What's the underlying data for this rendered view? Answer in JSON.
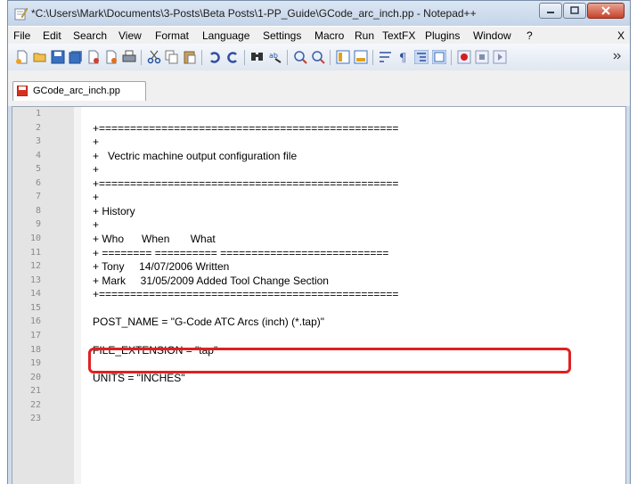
{
  "window": {
    "title": "*C:\\Users\\Mark\\Documents\\3-Posts\\Beta Posts\\1-PP_Guide\\GCode_arc_inch.pp - Notepad++"
  },
  "menu": {
    "items": [
      "File",
      "Edit",
      "Search",
      "View",
      "Format",
      "Language",
      "Settings",
      "Macro",
      "Run",
      "TextFX",
      "Plugins",
      "Window",
      "?"
    ],
    "close_label": "X"
  },
  "tab": {
    "label": "GCode_arc_inch.pp"
  },
  "editor": {
    "lines": [
      {
        "num": "1",
        "text": ""
      },
      {
        "num": "2",
        "text": "+================================================"
      },
      {
        "num": "3",
        "text": "+"
      },
      {
        "num": "4",
        "text": "+   Vectric machine output configuration file"
      },
      {
        "num": "5",
        "text": "+"
      },
      {
        "num": "6",
        "text": "+================================================"
      },
      {
        "num": "7",
        "text": "+"
      },
      {
        "num": "8",
        "text": "+ History"
      },
      {
        "num": "9",
        "text": "+"
      },
      {
        "num": "10",
        "text": "+ Who      When       What"
      },
      {
        "num": "11",
        "text": "+ ======== ========== ==========================="
      },
      {
        "num": "12",
        "text": "+ Tony     14/07/2006 Written"
      },
      {
        "num": "13",
        "text": "+ Mark     31/05/2009 Added Tool Change Section"
      },
      {
        "num": "14",
        "text": "+================================================"
      },
      {
        "num": "15",
        "text": ""
      },
      {
        "num": "16",
        "text": "POST_NAME = \"G-Code ATC Arcs (inch) (*.tap)\""
      },
      {
        "num": "17",
        "text": ""
      },
      {
        "num": "18",
        "text": "FILE_EXTENSION = \"tap\""
      },
      {
        "num": "19",
        "text": ""
      },
      {
        "num": "20",
        "text": "UNITS = \"INCHES\""
      },
      {
        "num": "21",
        "text": ""
      },
      {
        "num": "22",
        "text": ""
      },
      {
        "num": "23",
        "text": ""
      }
    ]
  },
  "colors": {
    "highlight": "#e02020",
    "gutter": "#e4e4e4",
    "close": "#c7422b"
  }
}
